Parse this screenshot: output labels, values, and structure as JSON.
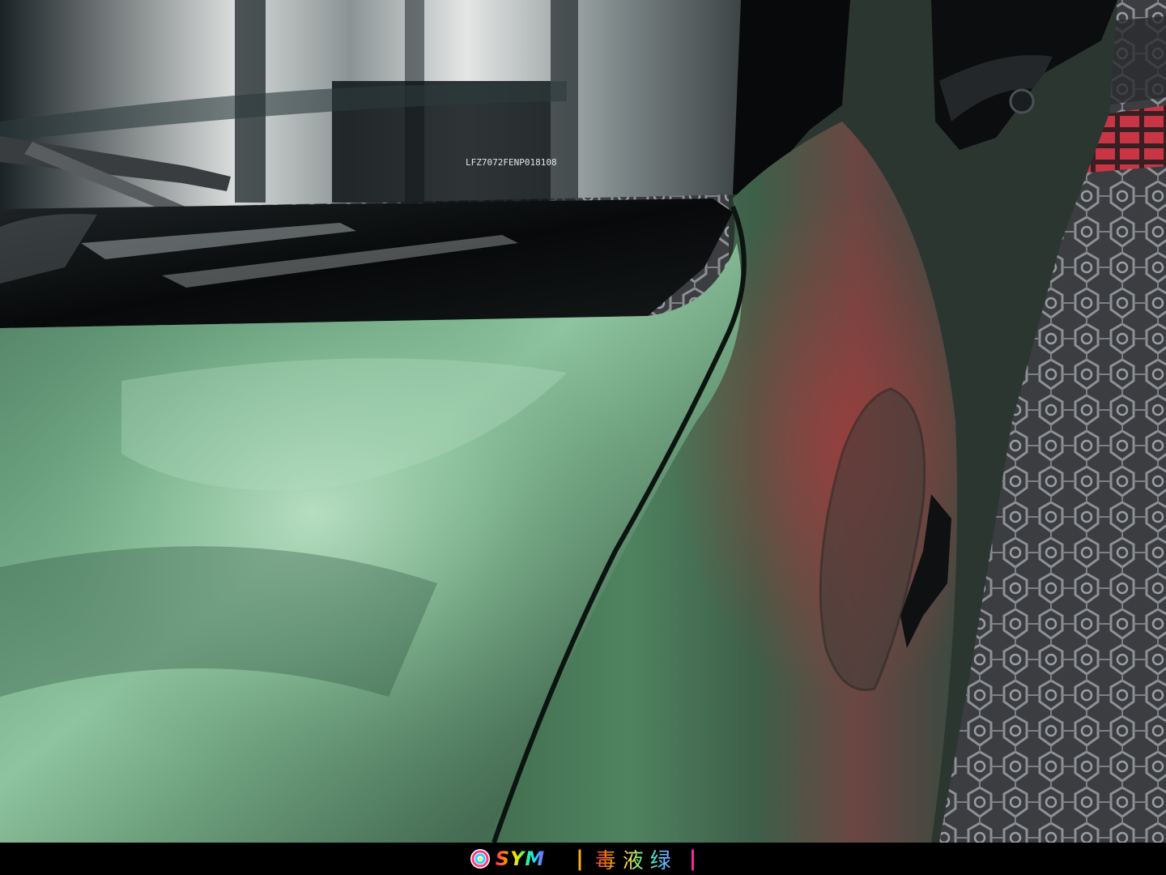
{
  "photo": {
    "subject": "car-body-photo",
    "colors": {
      "wrap_green_dark": "#2f4a3a",
      "wrap_green_mid": "#4a7a5a",
      "wrap_green_light": "#7fb894",
      "wrap_highlight": "#a9d6b6",
      "gloss_black": "#0a0c0d",
      "window_tint": "#6f7d80",
      "floor_grey": "#4a4c4f",
      "floor_red_stripe": "#d2384a"
    }
  },
  "windshield": {
    "vin_sticker_text": "LFZ7072FENP018108"
  },
  "caption": {
    "brand": "SYM",
    "product": "毒液绿",
    "separator_left": "|",
    "separator_right": "|"
  }
}
